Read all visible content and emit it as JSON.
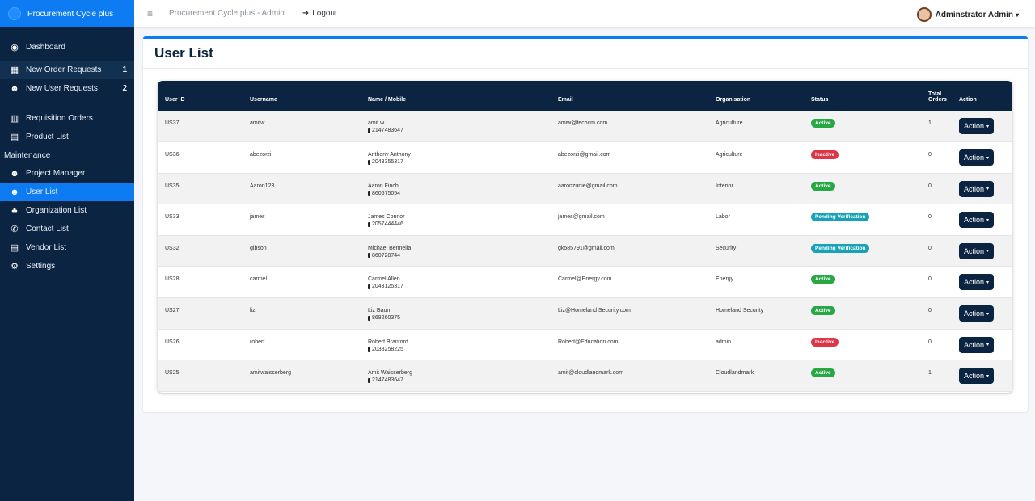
{
  "sidebar": {
    "brand": "Procurement Cycle plus",
    "items": [
      {
        "label": "Dashboard",
        "icon": "tachometer-icon",
        "glyph": "◉"
      },
      {
        "label": "New Order Requests",
        "icon": "boxes-icon",
        "glyph": "▦",
        "count": "1"
      },
      {
        "label": "New User Requests",
        "icon": "user-plus-icon",
        "glyph": "☻",
        "count": "2"
      },
      {
        "label": "Requisition Orders",
        "icon": "dolly-icon",
        "glyph": "▥"
      },
      {
        "label": "Product List",
        "icon": "file-icon",
        "glyph": "▤"
      },
      {
        "label": "Project Manager",
        "icon": "users-icon",
        "glyph": "☻"
      },
      {
        "label": "User List",
        "icon": "users-icon",
        "glyph": "☻"
      },
      {
        "label": "Organization List",
        "icon": "sitemap-icon",
        "glyph": "♣"
      },
      {
        "label": "Contact List",
        "icon": "phone-icon",
        "glyph": "✆"
      },
      {
        "label": "Vendor List",
        "icon": "file-icon",
        "glyph": "▤"
      },
      {
        "label": "Settings",
        "icon": "gears-icon",
        "glyph": "⚙"
      }
    ],
    "section_label": "Maintenance"
  },
  "topbar": {
    "menu_glyph": "≡",
    "app_link": "Procurement Cycle plus - Admin",
    "logout_glyph": "➜",
    "logout": "Logout",
    "user": "Adminstrator Admin",
    "caret": "▾"
  },
  "page": {
    "title": "User List"
  },
  "table": {
    "headers": {
      "id": "User ID",
      "username": "Username",
      "name": "Name / Mobile",
      "email": "Email",
      "org": "Organisation",
      "status": "Status",
      "orders_1": "Total",
      "orders_2": "Orders",
      "action": "Action"
    },
    "action_label": "Action",
    "action_caret": "▾",
    "rows": [
      {
        "id": "US37",
        "username": "amitw",
        "name": "amit w",
        "mobile": "2147483647",
        "email": "amiw@techcm.com",
        "org": "Agriculture",
        "status": "Active",
        "status_type": "active",
        "orders": "1"
      },
      {
        "id": "US36",
        "username": "abezorzi",
        "name": "Anthony Anthony",
        "mobile": "2043355317",
        "email": "abezorzi@gmail.com",
        "org": "Agriculture",
        "status": "Inactive",
        "status_type": "inactive",
        "orders": "0"
      },
      {
        "id": "US35",
        "username": "Aaron123",
        "name": "Aaron Finch",
        "mobile": "860675054",
        "email": "aaronzunie@gmail.com",
        "org": "Interior",
        "status": "Active",
        "status_type": "active",
        "orders": "0"
      },
      {
        "id": "US33",
        "username": "james",
        "name": "James Connor",
        "mobile": "2057444446",
        "email": "james@gmail.com",
        "org": "Labor",
        "status": "Pending Verification",
        "status_type": "pending",
        "orders": "0"
      },
      {
        "id": "US32",
        "username": "gibson",
        "name": "Michael Bennella",
        "mobile": "860728744",
        "email": "gk585791@gmail.com",
        "org": "Security",
        "status": "Pending Verification",
        "status_type": "pending",
        "orders": "0"
      },
      {
        "id": "US28",
        "username": "carmel",
        "name": "Carmel Allen",
        "mobile": "2043125317",
        "email": "Carmel@Energy.com",
        "org": "Energy",
        "status": "Active",
        "status_type": "active",
        "orders": "0"
      },
      {
        "id": "US27",
        "username": "liz",
        "name": "Liz Baum",
        "mobile": "868260375",
        "email": "Liz@Homeland Security.com",
        "org": "Homeland Security",
        "status": "Active",
        "status_type": "active",
        "orders": "0"
      },
      {
        "id": "US26",
        "username": "robert",
        "name": "Robert Branford",
        "mobile": "2038258225",
        "email": "Robert@Education.com",
        "org": "admin",
        "status": "Inactive",
        "status_type": "inactive",
        "orders": "0"
      },
      {
        "id": "US25",
        "username": "amitwaisserberg",
        "name": "Amit Waisserberg",
        "mobile": "2147483647",
        "email": "amit@cloudlandmark.com",
        "org": "Cloudlandmark",
        "status": "Active",
        "status_type": "active",
        "orders": "1"
      }
    ]
  }
}
